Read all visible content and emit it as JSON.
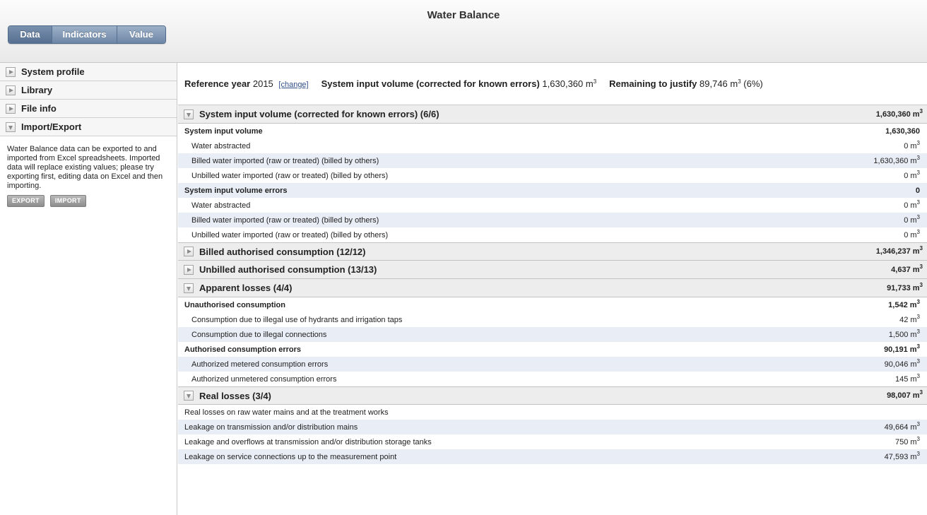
{
  "app": {
    "title": "Water Balance"
  },
  "tabs": [
    {
      "label": "Data",
      "active": true
    },
    {
      "label": "Indicators",
      "active": false
    },
    {
      "label": "Value",
      "active": false
    }
  ],
  "sidebar": {
    "items": [
      {
        "label": "System profile",
        "expanded": false
      },
      {
        "label": "Library",
        "expanded": false
      },
      {
        "label": "File info",
        "expanded": false
      },
      {
        "label": "Import/Export",
        "expanded": true
      }
    ],
    "import_export": {
      "description": "Water Balance data can be exported to and imported from Excel spreadsheets. Imported data will replace existing values; please try exporting first, editing data on Excel and then importing.",
      "export_label": "EXPORT",
      "import_label": "IMPORT"
    }
  },
  "summary": {
    "ref_year_label": "Reference year",
    "ref_year_value": "2015",
    "change_label": "[change]",
    "siv_label": "System input volume (corrected for known errors)",
    "siv_value": "1,630,360 m",
    "remaining_label": "Remaining to justify",
    "remaining_value": "89,746 m",
    "remaining_pct": "(6%)",
    "unit_sup": "3"
  },
  "sections": {
    "s1": {
      "title": "System input volume (corrected for known errors) (6/6)",
      "value": "1,630,360 m",
      "rows": [
        {
          "label": "System input volume",
          "value": "1,630,360",
          "unit": ""
        },
        {
          "label": "Water abstracted",
          "value": "0 m",
          "unit": "3"
        },
        {
          "label": "Billed water imported (raw or treated) (billed by others)",
          "value": "1,630,360 m",
          "unit": "3"
        },
        {
          "label": "Unbilled water imported (raw or treated) (billed by others)",
          "value": "0 m",
          "unit": "3"
        },
        {
          "label": "System input volume errors",
          "value": "0",
          "unit": ""
        },
        {
          "label": "Water abstracted",
          "value": "0 m",
          "unit": "3"
        },
        {
          "label": "Billed water imported (raw or treated) (billed by others)",
          "value": "0 m",
          "unit": "3"
        },
        {
          "label": "Unbilled water imported (raw or treated) (billed by others)",
          "value": "0 m",
          "unit": "3"
        }
      ]
    },
    "s2": {
      "title": "Billed authorised consumption (12/12)",
      "value": "1,346,237 m"
    },
    "s3": {
      "title": "Unbilled authorised consumption (13/13)",
      "value": "4,637 m"
    },
    "s4": {
      "title": "Apparent losses (4/4)",
      "value": "91,733 m",
      "rows": [
        {
          "label": "Unauthorised consumption",
          "value": "1,542 m",
          "unit": "3"
        },
        {
          "label": "Consumption due to illegal use of hydrants and irrigation taps",
          "value": "42 m",
          "unit": "3"
        },
        {
          "label": "Consumption due to illegal connections",
          "value": "1,500 m",
          "unit": "3"
        },
        {
          "label": "Authorised consumption errors",
          "value": "90,191 m",
          "unit": "3"
        },
        {
          "label": "Authorized metered consumption errors",
          "value": "90,046 m",
          "unit": "3"
        },
        {
          "label": "Authorized unmetered consumption errors",
          "value": "145 m",
          "unit": "3"
        }
      ]
    },
    "s5": {
      "title": "Real losses (3/4)",
      "value": "98,007 m",
      "rows": [
        {
          "label": "Real losses on raw water mains and at the treatment works",
          "value": "",
          "unit": ""
        },
        {
          "label": "Leakage on transmission and/or distribution mains",
          "value": "49,664 m",
          "unit": "3"
        },
        {
          "label": "Leakage and overflows at transmission and/or distribution storage tanks",
          "value": "750 m",
          "unit": "3"
        },
        {
          "label": "Leakage on service connections up to the measurement point",
          "value": "47,593 m",
          "unit": "3"
        }
      ]
    }
  }
}
